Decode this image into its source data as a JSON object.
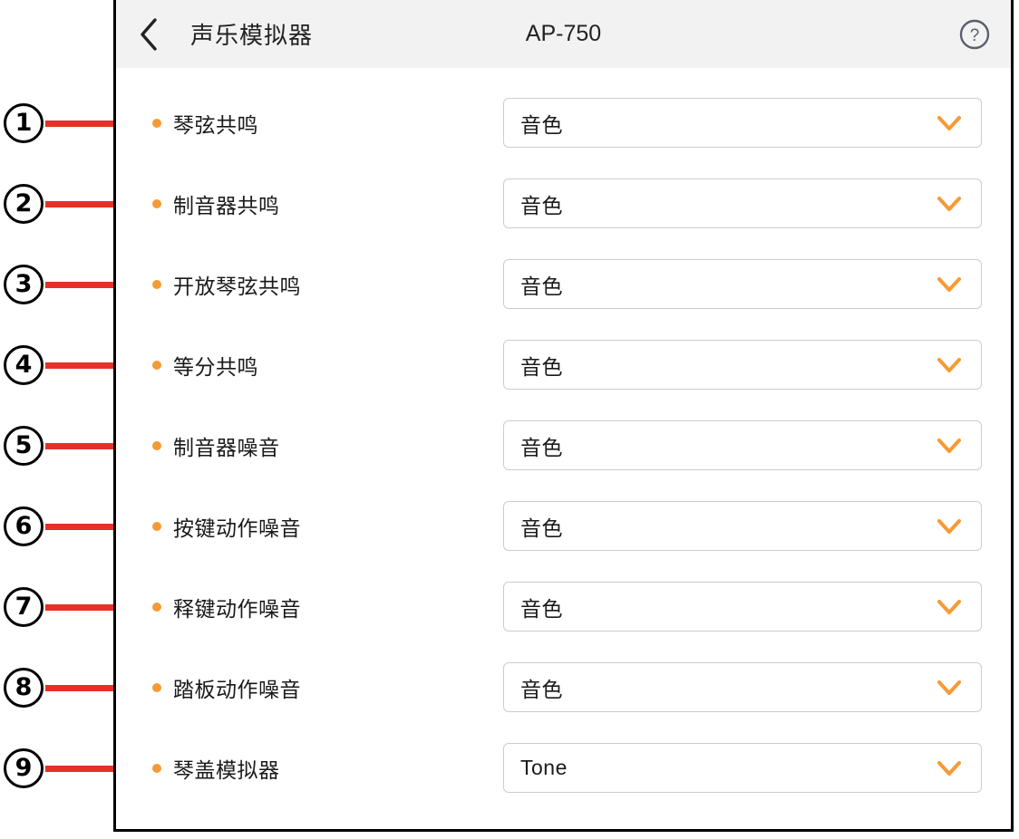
{
  "header": {
    "back_icon": "chevron-left-icon",
    "title": "声乐模拟器",
    "model": "AP-750",
    "help_icon": "help-circle-icon"
  },
  "colors": {
    "callout_line": "#E53228",
    "bullet": "#F59A37",
    "chevron": "#F79A35",
    "header_bg": "#f2f2f2",
    "panel_border": "#000000",
    "field_border": "#c9cdd1",
    "help_icon": "#5a5f6b"
  },
  "callouts": [
    {
      "number": "1"
    },
    {
      "number": "2"
    },
    {
      "number": "3"
    },
    {
      "number": "4"
    },
    {
      "number": "5"
    },
    {
      "number": "6"
    },
    {
      "number": "7"
    },
    {
      "number": "8"
    },
    {
      "number": "9"
    }
  ],
  "rows": [
    {
      "label": "琴弦共鸣",
      "value": "音色"
    },
    {
      "label": "制音器共鸣",
      "value": "音色"
    },
    {
      "label": "开放琴弦共鸣",
      "value": "音色"
    },
    {
      "label": "等分共鸣",
      "value": "音色"
    },
    {
      "label": "制音器噪音",
      "value": "音色"
    },
    {
      "label": "按键动作噪音",
      "value": "音色"
    },
    {
      "label": "释键动作噪音",
      "value": "音色"
    },
    {
      "label": "踏板动作噪音",
      "value": "音色"
    },
    {
      "label": "琴盖模拟器",
      "value": "Tone"
    }
  ]
}
